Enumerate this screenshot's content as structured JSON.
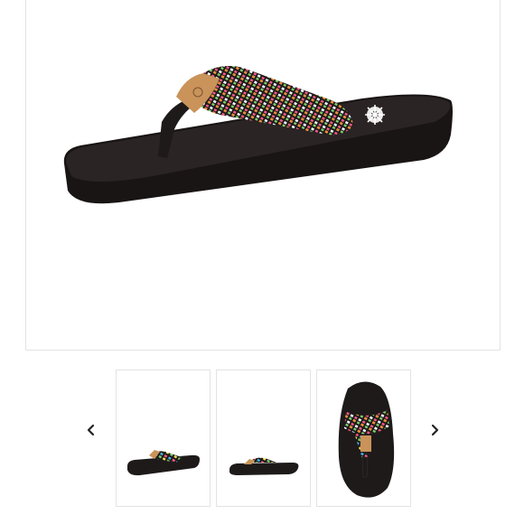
{
  "gallery": {
    "main_image": {
      "alt": "",
      "icon": "flip-flop-sandal-image"
    },
    "prev_icon": "chevron-left-icon",
    "next_icon": "chevron-right-icon",
    "thumbnails": [
      {
        "view": "side-angle",
        "selected": false
      },
      {
        "view": "side-profile",
        "selected": false
      },
      {
        "view": "top-down",
        "selected": true
      }
    ],
    "colors": {
      "sole": "#1f1a1a",
      "strap_colors": [
        "#ff5a8a",
        "#3fb6e8",
        "#f7e35b",
        "#7dd06b",
        "#ffffff",
        "#f08a3c",
        "#b56ad6"
      ],
      "logo_tag": "#c9935a",
      "border": "#e3e3e3"
    }
  }
}
